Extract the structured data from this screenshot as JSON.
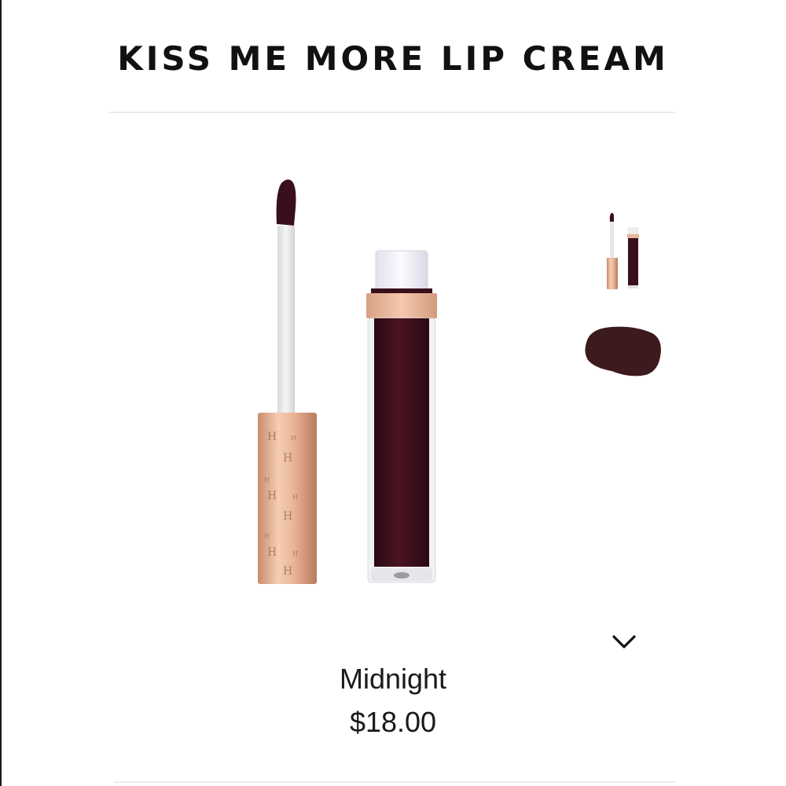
{
  "product": {
    "title": "KISS ME MORE LIP CREAM",
    "shade": "Midnight",
    "price": "$18.00"
  },
  "gallery": {
    "main_image": "lip-cream-wand-and-tube",
    "thumbnails": [
      "product-thumbnail",
      "swatch-thumbnail"
    ],
    "expand_icon": "chevron-down-icon"
  },
  "colors": {
    "shade": "#3a0f1c",
    "rose_gold": "#e8b59a",
    "swatch": "#3d1a1e"
  }
}
